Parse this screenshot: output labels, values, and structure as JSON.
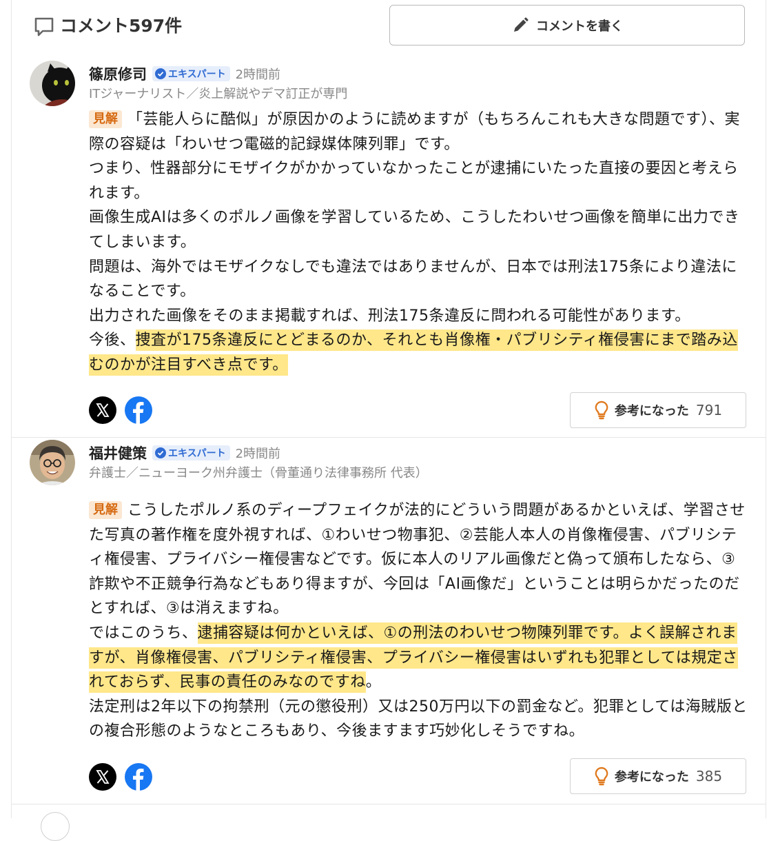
{
  "header": {
    "title": "コメント597件",
    "write_label": "コメントを書く"
  },
  "comments": [
    {
      "name": "篠原修司",
      "badge": "エキスパート",
      "time": "2時間前",
      "profile": "ITジャーナリスト／炎上解説やデマ訂正が専門",
      "tag": "見解",
      "text_a": "「芸能人らに酷似」が原因かのように読めますが（もちろんこれも大きな問題です）、実際の容疑は「わいせつ電磁的記録媒体陳列罪」です。",
      "text_b": "つまり、性器部分にモザイクがかかっていなかったことが逮捕にいたった直接の要因と考えられます。",
      "text_c": "画像生成AIは多くのポルノ画像を学習しているため、こうしたわいせつ画像を簡単に出力できてしまいます。",
      "text_d": "問題は、海外ではモザイクなしでも違法ではありませんが、日本では刑法175条により違法になることです。",
      "text_e": "出力された画像をそのまま掲載すれば、刑法175条違反に問われる可能性があります。",
      "text_f_pre": "今後、",
      "text_f_hl": "捜査が175条違反にとどまるのか、それとも肖像権・パブリシティ権侵害にまで踏み込むのかが注目すべき点です。",
      "useful_label": "参考になった",
      "useful_count": "791"
    },
    {
      "name": "福井健策",
      "badge": "エキスパート",
      "time": "2時間前",
      "profile": "弁護士／ニューヨーク州弁護士（骨董通り法律事務所 代表）",
      "tag": "見解",
      "text_a": "こうしたポルノ系のディープフェイクが法的にどういう問題があるかといえば、学習させた写真の著作権を度外視すれば、①わいせつ物事犯、②芸能人本人の肖像権侵害、パブリシティ権侵害、プライバシー権侵害などです。仮に本人のリアル画像だと偽って頒布したなら、③詐欺や不正競争行為などもあり得ますが、今回は「AI画像だ」ということは明らかだったのだとすれば、③は消えますね。",
      "text_b_pre": "ではこのうち、",
      "text_b_hl": "逮捕容疑は何かといえば、①の刑法のわいせつ物陳列罪です。よく誤解されますが、肖像権侵害、パブリシティ権侵害、プライバシー権侵害はいずれも犯罪としては規定されておらず、民事の責任のみなのですね",
      "text_b_post": "。",
      "text_c": "法定刑は2年以下の拘禁刑（元の懲役刑）又は250万円以下の罰金など。犯罪としては海賊版との複合形態のようなところもあり、今後ますます巧妙化しそうですね。",
      "useful_label": "参考になった",
      "useful_count": "385"
    }
  ]
}
